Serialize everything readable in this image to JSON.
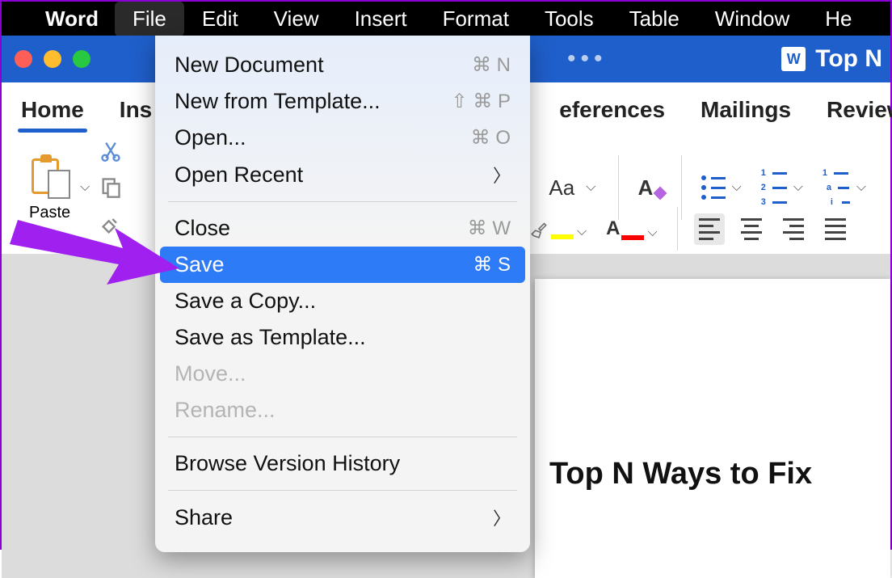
{
  "menubar": {
    "app": "Word",
    "items": [
      "File",
      "Edit",
      "View",
      "Insert",
      "Format",
      "Tools",
      "Table",
      "Window",
      "He"
    ]
  },
  "titlebar": {
    "doc": "Top N"
  },
  "ribbon": {
    "tabs": {
      "home": "Home",
      "insert": "Ins",
      "references": "eferences",
      "mailings": "Mailings",
      "review": "Review"
    },
    "paste": "Paste",
    "font_indicator": "Aa"
  },
  "file_menu": {
    "new_document": {
      "label": "New Document",
      "shortcut": "⌘ N"
    },
    "new_template": {
      "label": "New from Template...",
      "shortcut": "⇧ ⌘ P"
    },
    "open": {
      "label": "Open...",
      "shortcut": "⌘ O"
    },
    "open_recent": {
      "label": "Open Recent"
    },
    "close": {
      "label": "Close",
      "shortcut": "⌘ W"
    },
    "save": {
      "label": "Save",
      "shortcut": "⌘ S"
    },
    "save_copy": {
      "label": "Save a Copy..."
    },
    "save_template": {
      "label": "Save as Template..."
    },
    "move": {
      "label": "Move..."
    },
    "rename": {
      "label": "Rename..."
    },
    "history": {
      "label": "Browse Version History"
    },
    "share": {
      "label": "Share"
    }
  },
  "document": {
    "heading": "Top N Ways to Fix "
  }
}
